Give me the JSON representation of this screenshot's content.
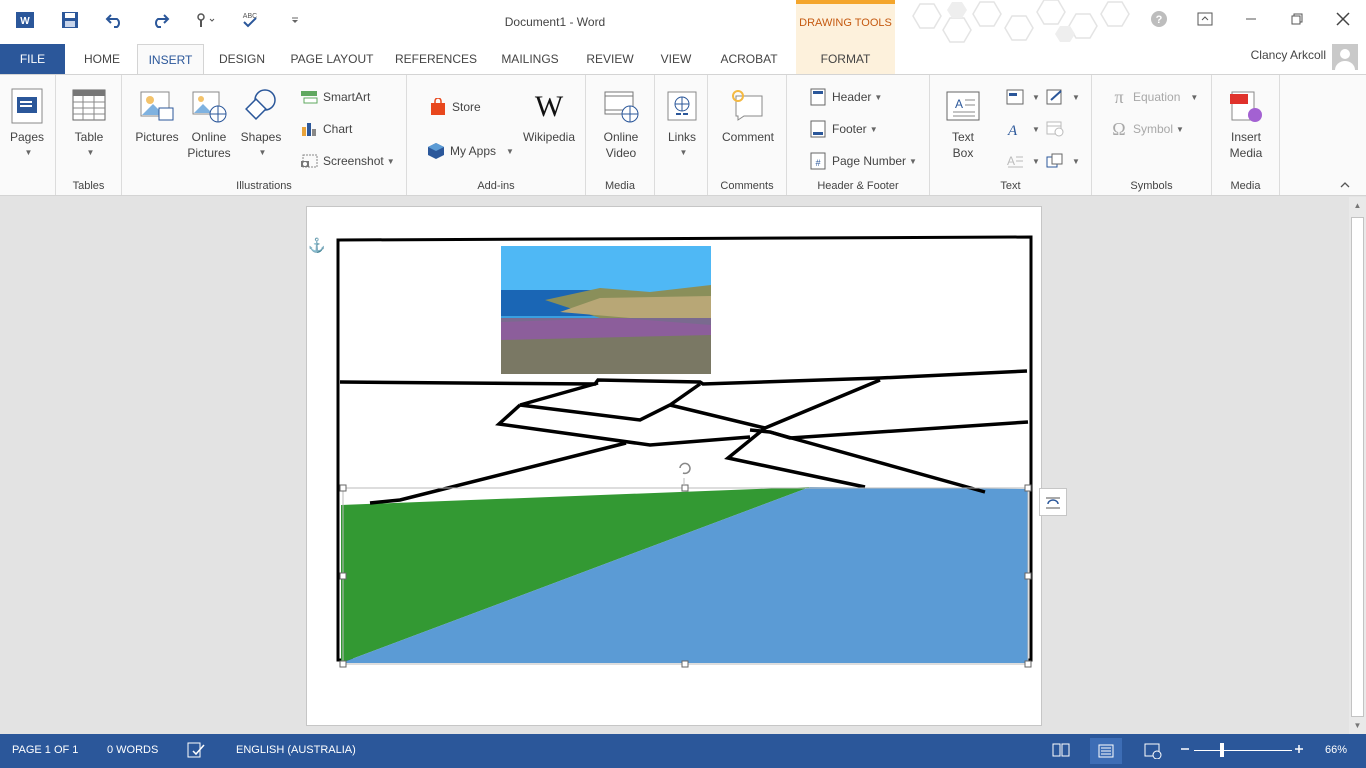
{
  "window": {
    "title": "Document1 - Word",
    "context_header": "DRAWING TOOLS",
    "user_name": "Clancy Arkcoll"
  },
  "tabs": [
    "FILE",
    "HOME",
    "INSERT",
    "DESIGN",
    "PAGE LAYOUT",
    "REFERENCES",
    "MAILINGS",
    "REVIEW",
    "VIEW",
    "ACROBAT",
    "FORMAT"
  ],
  "active_tab": "INSERT",
  "ribbon": {
    "pages": {
      "label": "Pages"
    },
    "tables": {
      "table": "Table",
      "group": "Tables"
    },
    "illustrations": {
      "pictures": "Pictures",
      "online_pictures_1": "Online",
      "online_pictures_2": "Pictures",
      "shapes": "Shapes",
      "smartart": "SmartArt",
      "chart": "Chart",
      "screenshot": "Screenshot",
      "group": "Illustrations"
    },
    "addins": {
      "store": "Store",
      "my_apps": "My Apps",
      "wikipedia": "Wikipedia",
      "group": "Add-ins"
    },
    "media": {
      "online_video_1": "Online",
      "online_video_2": "Video",
      "group": "Media"
    },
    "links": {
      "label": "Links"
    },
    "comments": {
      "comment": "Comment",
      "group": "Comments"
    },
    "header_footer": {
      "header": "Header",
      "footer": "Footer",
      "page_number": "Page Number",
      "group": "Header & Footer"
    },
    "text": {
      "text_box_1": "Text",
      "text_box_2": "Box",
      "group": "Text"
    },
    "symbols": {
      "equation": "Equation",
      "symbol": "Symbol",
      "group": "Symbols"
    },
    "media2": {
      "insert_media_1": "Insert",
      "insert_media_2": "Media",
      "group": "Media"
    }
  },
  "status": {
    "page": "PAGE 1 OF 1",
    "words": "0 WORDS",
    "language": "ENGLISH (AUSTRALIA)",
    "zoom": "66%"
  },
  "colors": {
    "word_blue": "#2b579a",
    "drawing_tools_accent": "#c55a11",
    "shape_green": "#339933",
    "shape_blue": "#5b9bd5"
  }
}
